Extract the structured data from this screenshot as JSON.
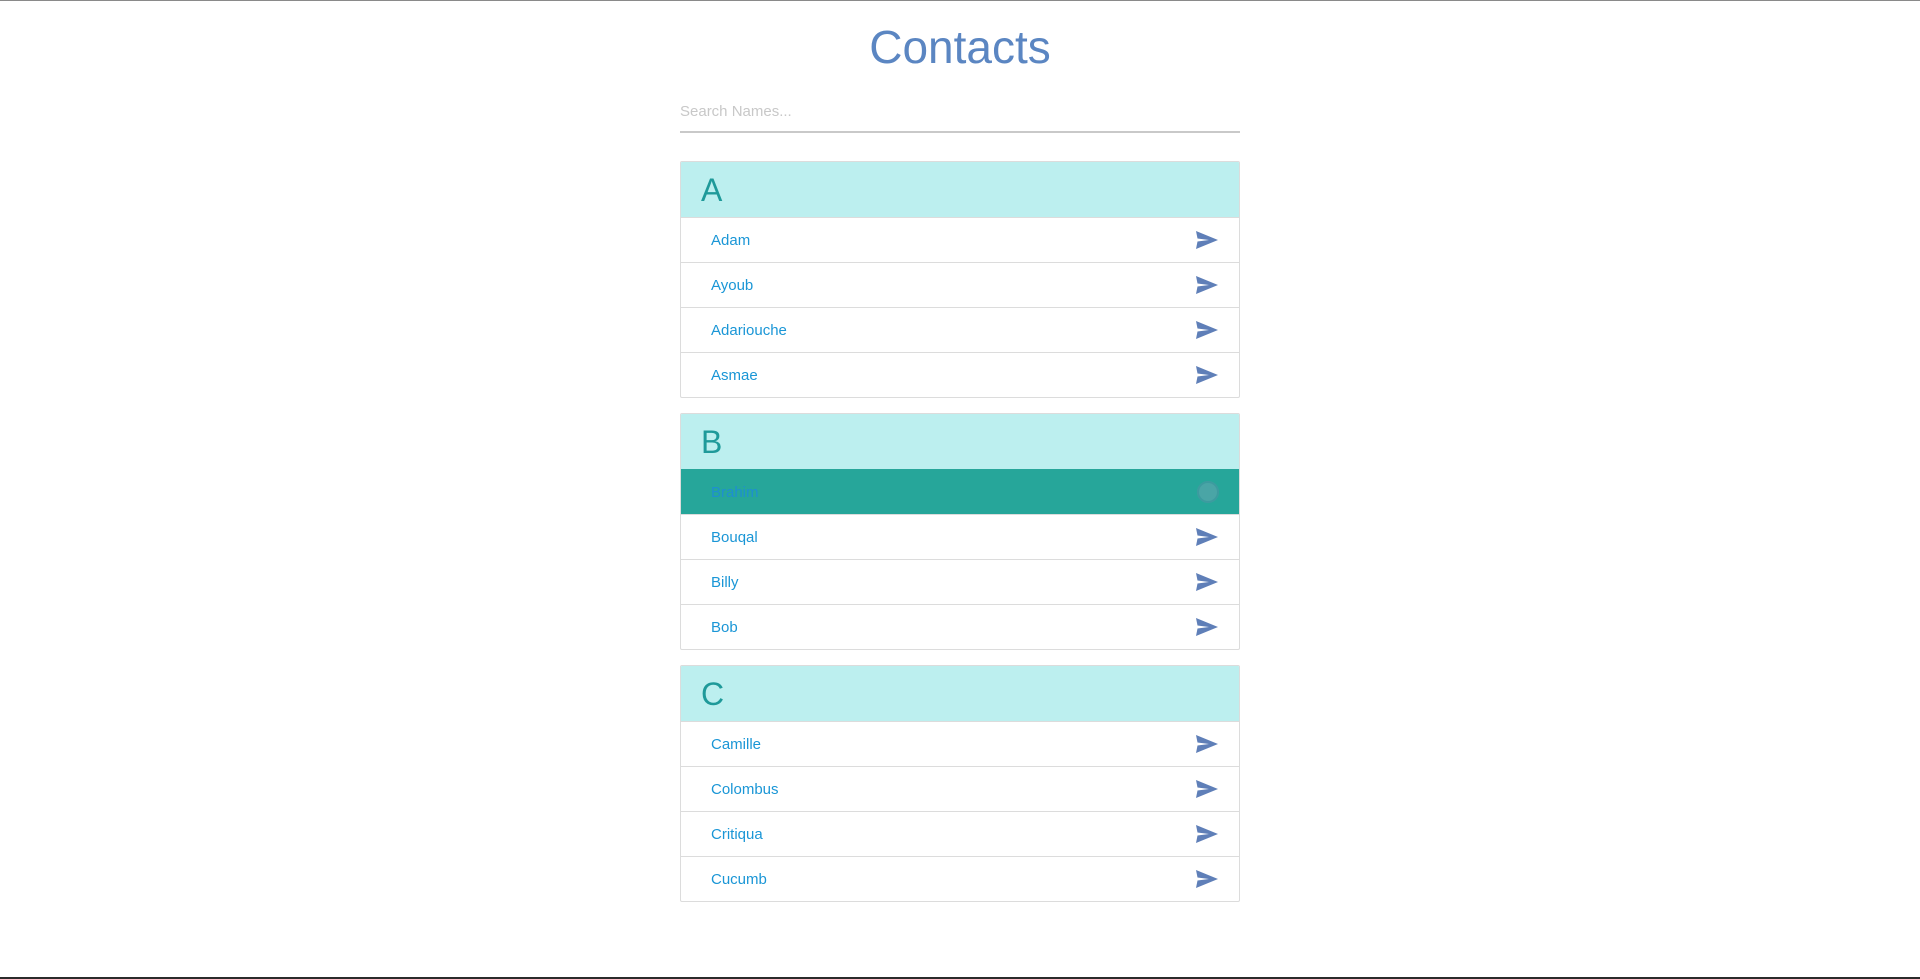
{
  "page": {
    "title": "Contacts"
  },
  "search": {
    "placeholder": "Search Names...",
    "value": ""
  },
  "groups": [
    {
      "letter": "A",
      "contacts": [
        "Adam",
        "Ayoub",
        "Adariouche",
        "Asmae"
      ]
    },
    {
      "letter": "B",
      "contacts": [
        "Brahim",
        "Bouqal",
        "Billy",
        "Bob"
      ]
    },
    {
      "letter": "C",
      "contacts": [
        "Camille",
        "Colombus",
        "Critiqua",
        "Cucumb"
      ]
    }
  ],
  "active_contact": "Brahim",
  "colors": {
    "title": "#5b86c2",
    "group_header_bg": "#bcefef",
    "group_letter": "#1f9a9a",
    "contact_name": "#1a96d6",
    "active_row_bg": "#26a69a",
    "send_icon": "#5f7fb8"
  },
  "icons": {
    "send": "send-icon",
    "active": "circle-icon"
  }
}
